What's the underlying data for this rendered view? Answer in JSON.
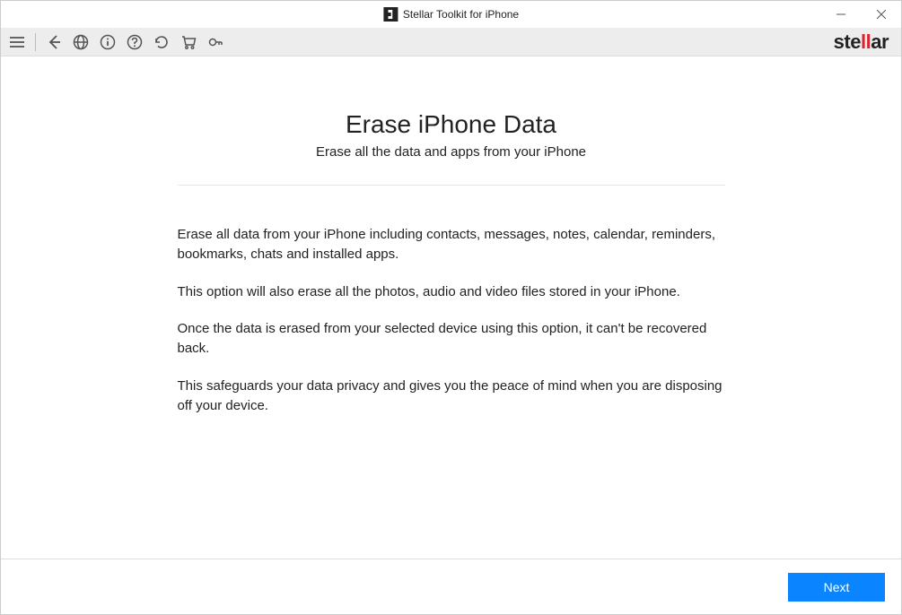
{
  "window": {
    "title": "Stellar Toolkit for iPhone"
  },
  "toolbar": {
    "brand_prefix": "ste",
    "brand_accent": "ll",
    "brand_suffix": "ar"
  },
  "page": {
    "heading": "Erase iPhone Data",
    "subheading": "Erase all the data and apps from your iPhone",
    "p1": "Erase all data from your iPhone including contacts, messages, notes, calendar, reminders, bookmarks, chats and installed apps.",
    "p2": "This option will also erase all the photos, audio and video files stored in your iPhone.",
    "p3": "Once the data is erased from your selected device using this option, it can't be recovered back.",
    "p4": "This safeguards your data privacy and gives you the peace of mind when you are disposing off your device."
  },
  "footer": {
    "next_label": "Next"
  }
}
